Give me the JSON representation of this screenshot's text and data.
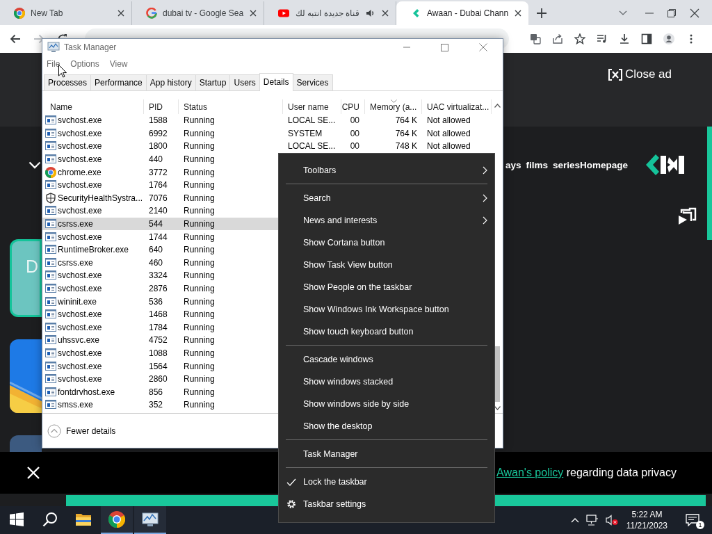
{
  "browser": {
    "tabs": [
      {
        "title": "New Tab",
        "kind": "chrome",
        "audio": false,
        "selected": false
      },
      {
        "title": "dubai tv - Google Sea",
        "kind": "google",
        "audio": false,
        "selected": false
      },
      {
        "title": "قناة جديدة انتبه لك",
        "kind": "youtube",
        "audio": true,
        "selected": false
      },
      {
        "title": "Awaan - Dubai Chann",
        "kind": "awaan",
        "audio": false,
        "selected": true
      }
    ],
    "nav_buttons": [
      {
        "kind": "back",
        "disabled": false
      },
      {
        "kind": "forward",
        "disabled": true
      },
      {
        "kind": "reload",
        "disabled": false
      }
    ]
  },
  "page": {
    "close_ad": "Close ad",
    "nav": [
      "ays",
      "films",
      "seriesHomepage"
    ],
    "card_text": "D",
    "notice": {
      "link": "Awan's policy",
      "text": "regarding data privacy"
    }
  },
  "task_manager": {
    "title": "Task Manager",
    "menu": [
      "File",
      "Options",
      "View"
    ],
    "tabs": [
      {
        "label": "Processes",
        "selected": false
      },
      {
        "label": "Performance",
        "selected": false
      },
      {
        "label": "App history",
        "selected": false
      },
      {
        "label": "Startup",
        "selected": false
      },
      {
        "label": "Users",
        "selected": false
      },
      {
        "label": "Details",
        "selected": true
      },
      {
        "label": "Services",
        "selected": false
      }
    ],
    "columns": [
      {
        "label": "Name",
        "sorted": false
      },
      {
        "label": "PID",
        "sorted": false
      },
      {
        "label": "Status",
        "sorted": false
      },
      {
        "label": "User name",
        "sorted": false
      },
      {
        "label": "CPU",
        "sorted": false
      },
      {
        "label": "Memory (a...",
        "sorted": true
      },
      {
        "label": "UAC virtualizat...",
        "sorted": false
      }
    ],
    "rows": [
      {
        "kind": "app",
        "name": "svchost.exe",
        "pid": "1588",
        "status": "Running",
        "user": "LOCAL SE...",
        "cpu": "00",
        "memory": "764 K",
        "uac": "Not allowed",
        "selected": false
      },
      {
        "kind": "app",
        "name": "svchost.exe",
        "pid": "6992",
        "status": "Running",
        "user": "SYSTEM",
        "cpu": "00",
        "memory": "764 K",
        "uac": "Not allowed",
        "selected": false
      },
      {
        "kind": "app",
        "name": "svchost.exe",
        "pid": "1800",
        "status": "Running",
        "user": "LOCAL SE...",
        "cpu": "00",
        "memory": "748 K",
        "uac": "Not allowed",
        "selected": false
      },
      {
        "kind": "app",
        "name": "svchost.exe",
        "pid": "440",
        "status": "Running",
        "selected": false
      },
      {
        "kind": "chrome",
        "name": "chrome.exe",
        "pid": "3772",
        "status": "Running",
        "selected": false
      },
      {
        "kind": "app",
        "name": "svchost.exe",
        "pid": "1764",
        "status": "Running",
        "selected": false
      },
      {
        "kind": "shield",
        "name": "SecurityHealthSystra...",
        "pid": "7076",
        "status": "Running",
        "selected": false
      },
      {
        "kind": "app",
        "name": "svchost.exe",
        "pid": "2140",
        "status": "Running",
        "selected": false
      },
      {
        "kind": "app",
        "name": "csrss.exe",
        "pid": "544",
        "status": "Running",
        "selected": true
      },
      {
        "kind": "app",
        "name": "svchost.exe",
        "pid": "1744",
        "status": "Running",
        "selected": false
      },
      {
        "kind": "app",
        "name": "RuntimeBroker.exe",
        "pid": "640",
        "status": "Running",
        "selected": false
      },
      {
        "kind": "app",
        "name": "csrss.exe",
        "pid": "460",
        "status": "Running",
        "selected": false
      },
      {
        "kind": "app",
        "name": "svchost.exe",
        "pid": "3324",
        "status": "Running",
        "selected": false
      },
      {
        "kind": "app",
        "name": "svchost.exe",
        "pid": "2876",
        "status": "Running",
        "selected": false
      },
      {
        "kind": "app",
        "name": "wininit.exe",
        "pid": "536",
        "status": "Running",
        "selected": false
      },
      {
        "kind": "app",
        "name": "svchost.exe",
        "pid": "1468",
        "status": "Running",
        "selected": false
      },
      {
        "kind": "app",
        "name": "svchost.exe",
        "pid": "1784",
        "status": "Running",
        "selected": false
      },
      {
        "kind": "app",
        "name": "uhssvc.exe",
        "pid": "4752",
        "status": "Running",
        "selected": false
      },
      {
        "kind": "app",
        "name": "svchost.exe",
        "pid": "1088",
        "status": "Running",
        "selected": false
      },
      {
        "kind": "app",
        "name": "svchost.exe",
        "pid": "1564",
        "status": "Running",
        "selected": false
      },
      {
        "kind": "app",
        "name": "svchost.exe",
        "pid": "2860",
        "status": "Running",
        "selected": false
      },
      {
        "kind": "app",
        "name": "fontdrvhost.exe",
        "pid": "856",
        "status": "Running",
        "selected": false
      },
      {
        "kind": "app",
        "name": "smss.exe",
        "pid": "352",
        "status": "Running",
        "selected": false
      }
    ],
    "footer": "Fewer details"
  },
  "context_menu": {
    "items": [
      {
        "kind": "submenu",
        "label": "Toolbars"
      },
      {
        "kind": "separator"
      },
      {
        "kind": "submenu",
        "label": "Search"
      },
      {
        "kind": "submenu",
        "label": "News and interests"
      },
      {
        "kind": "item",
        "label": "Show Cortana button"
      },
      {
        "kind": "item",
        "label": "Show Task View button"
      },
      {
        "kind": "item",
        "label": "Show People on the taskbar"
      },
      {
        "kind": "item",
        "label": "Show Windows Ink Workspace button"
      },
      {
        "kind": "item",
        "label": "Show touch keyboard button"
      },
      {
        "kind": "separator"
      },
      {
        "kind": "item",
        "label": "Cascade windows"
      },
      {
        "kind": "item",
        "label": "Show windows stacked"
      },
      {
        "kind": "item",
        "label": "Show windows side by side"
      },
      {
        "kind": "item",
        "label": "Show the desktop"
      },
      {
        "kind": "separator"
      },
      {
        "kind": "item",
        "label": "Task Manager"
      },
      {
        "kind": "separator"
      },
      {
        "kind": "check",
        "label": "Lock the taskbar",
        "checked": true
      },
      {
        "kind": "settings",
        "label": "Taskbar settings"
      }
    ]
  },
  "taskbar": {
    "apps": [
      {
        "kind": "start",
        "open": false
      },
      {
        "kind": "search",
        "open": false
      },
      {
        "kind": "explorer",
        "open": false
      },
      {
        "kind": "chrome",
        "open": true
      },
      {
        "kind": "taskmgr",
        "open": true
      }
    ],
    "volume_muted": true,
    "time": "5:22 AM",
    "date": "11/21/2023",
    "notifications": "1"
  }
}
